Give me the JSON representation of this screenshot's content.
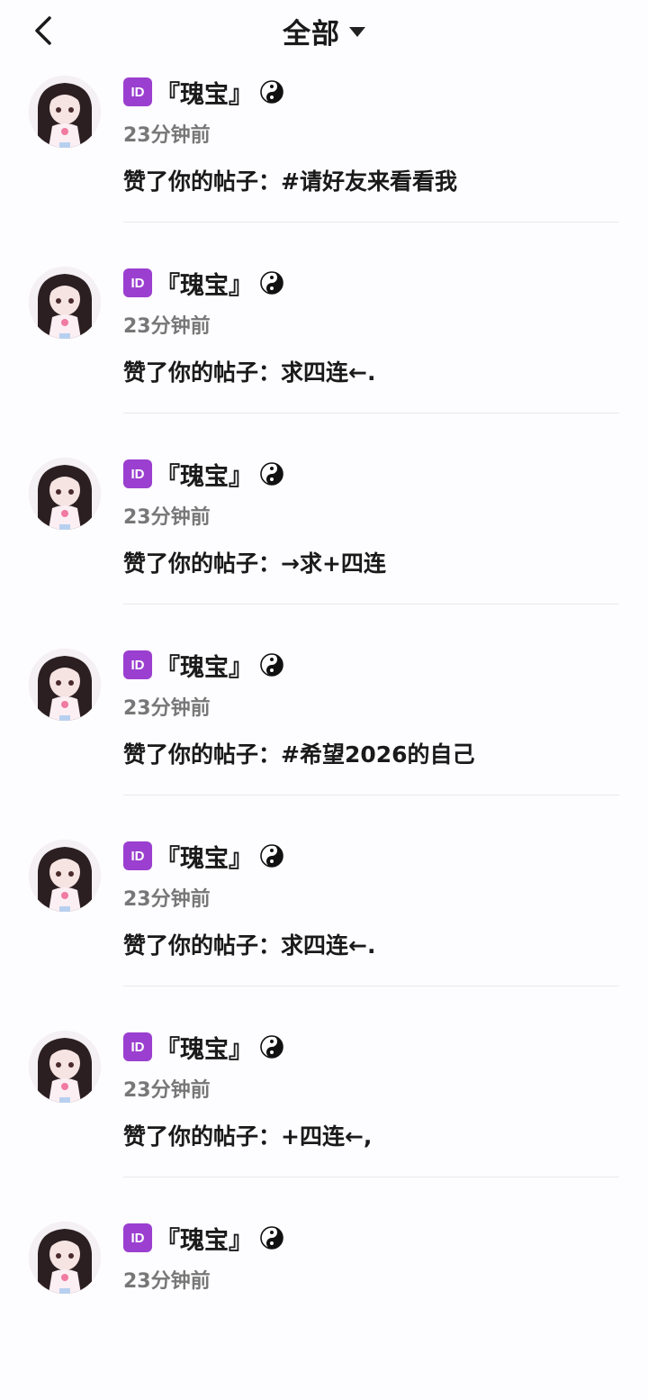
{
  "header": {
    "title": "全部",
    "back_icon": "chevron-left-icon",
    "dropdown_icon": "caret-down-icon"
  },
  "notifications": [
    {
      "badge": "ID",
      "name": "『瑰宝』",
      "time": "23分钟前",
      "content": "赞了你的帖子：#请好友来看看我"
    },
    {
      "badge": "ID",
      "name": "『瑰宝』",
      "time": "23分钟前",
      "content": "赞了你的帖子：求四连←."
    },
    {
      "badge": "ID",
      "name": "『瑰宝』",
      "time": "23分钟前",
      "content": "赞了你的帖子：→求+四连"
    },
    {
      "badge": "ID",
      "name": "『瑰宝』",
      "time": "23分钟前",
      "content": "赞了你的帖子：#希望2026的自己"
    },
    {
      "badge": "ID",
      "name": "『瑰宝』",
      "time": "23分钟前",
      "content": "赞了你的帖子：求四连←."
    },
    {
      "badge": "ID",
      "name": "『瑰宝』",
      "time": "23分钟前",
      "content": "赞了你的帖子：+四连←,"
    },
    {
      "badge": "ID",
      "name": "『瑰宝』",
      "time": "23分钟前",
      "content": ""
    }
  ],
  "colors": {
    "badge": "#9b3fd0",
    "time_text": "#777777",
    "divider": "#e9e9ec"
  }
}
